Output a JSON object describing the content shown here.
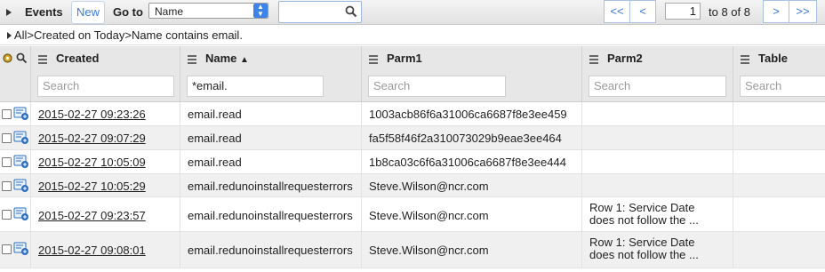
{
  "toolbar": {
    "title": "Events",
    "new_label": "New",
    "goto_label": "Go to",
    "goto_value": "Name",
    "search_value": "",
    "pager": {
      "first": "<<",
      "prev": "<",
      "page": "1",
      "of_text": "to 8 of 8",
      "next": ">",
      "last": ">>"
    }
  },
  "breadcrumb": {
    "root": "All",
    "sep1": ">",
    "item1": "Created on Today",
    "sep2": ">",
    "item2": "Name contains email."
  },
  "columns": [
    {
      "label": "Created",
      "filter": "",
      "placeholder": "Search"
    },
    {
      "label": "Name",
      "sort": "▲",
      "filter": "*email.",
      "placeholder": "Search"
    },
    {
      "label": "Parm1",
      "filter": "",
      "placeholder": "Search"
    },
    {
      "label": "Parm2",
      "filter": "",
      "placeholder": "Search"
    },
    {
      "label": "Table",
      "filter": "",
      "placeholder": "Search"
    }
  ],
  "rows": [
    {
      "created": "2015-02-27 09:23:26",
      "name": "email.read",
      "parm1": "1003acb86f6a31006ca6687f8e3ee459",
      "parm2": "",
      "table": ""
    },
    {
      "created": "2015-02-27 09:07:29",
      "name": "email.read",
      "parm1": "fa5f58f46f2a310073029b9eae3ee464",
      "parm2": "",
      "table": ""
    },
    {
      "created": "2015-02-27 10:05:09",
      "name": "email.read",
      "parm1": "1b8ca03c6f6a31006ca6687f8e3ee444",
      "parm2": "",
      "table": ""
    },
    {
      "created": "2015-02-27 10:05:29",
      "name": "email.redunoinstallrequesterrors",
      "parm1": "Steve.Wilson@ncr.com",
      "parm2": "",
      "table": ""
    },
    {
      "created": "2015-02-27 09:23:57",
      "name": "email.redunoinstallrequesterrors",
      "parm1": "Steve.Wilson@ncr.com",
      "parm2": "Row 1: Service Date does not follow the ...",
      "table": ""
    },
    {
      "created": "2015-02-27 09:08:01",
      "name": "email.redunoinstallrequesterrors",
      "parm1": "Steve.Wilson@ncr.com",
      "parm2": "Row 1: Service Date does not follow the ...",
      "table": ""
    }
  ],
  "colors": {
    "accent": "#3b7bd6",
    "header_bg": "#e7e7e7",
    "row_alt": "#f0f0f0"
  }
}
